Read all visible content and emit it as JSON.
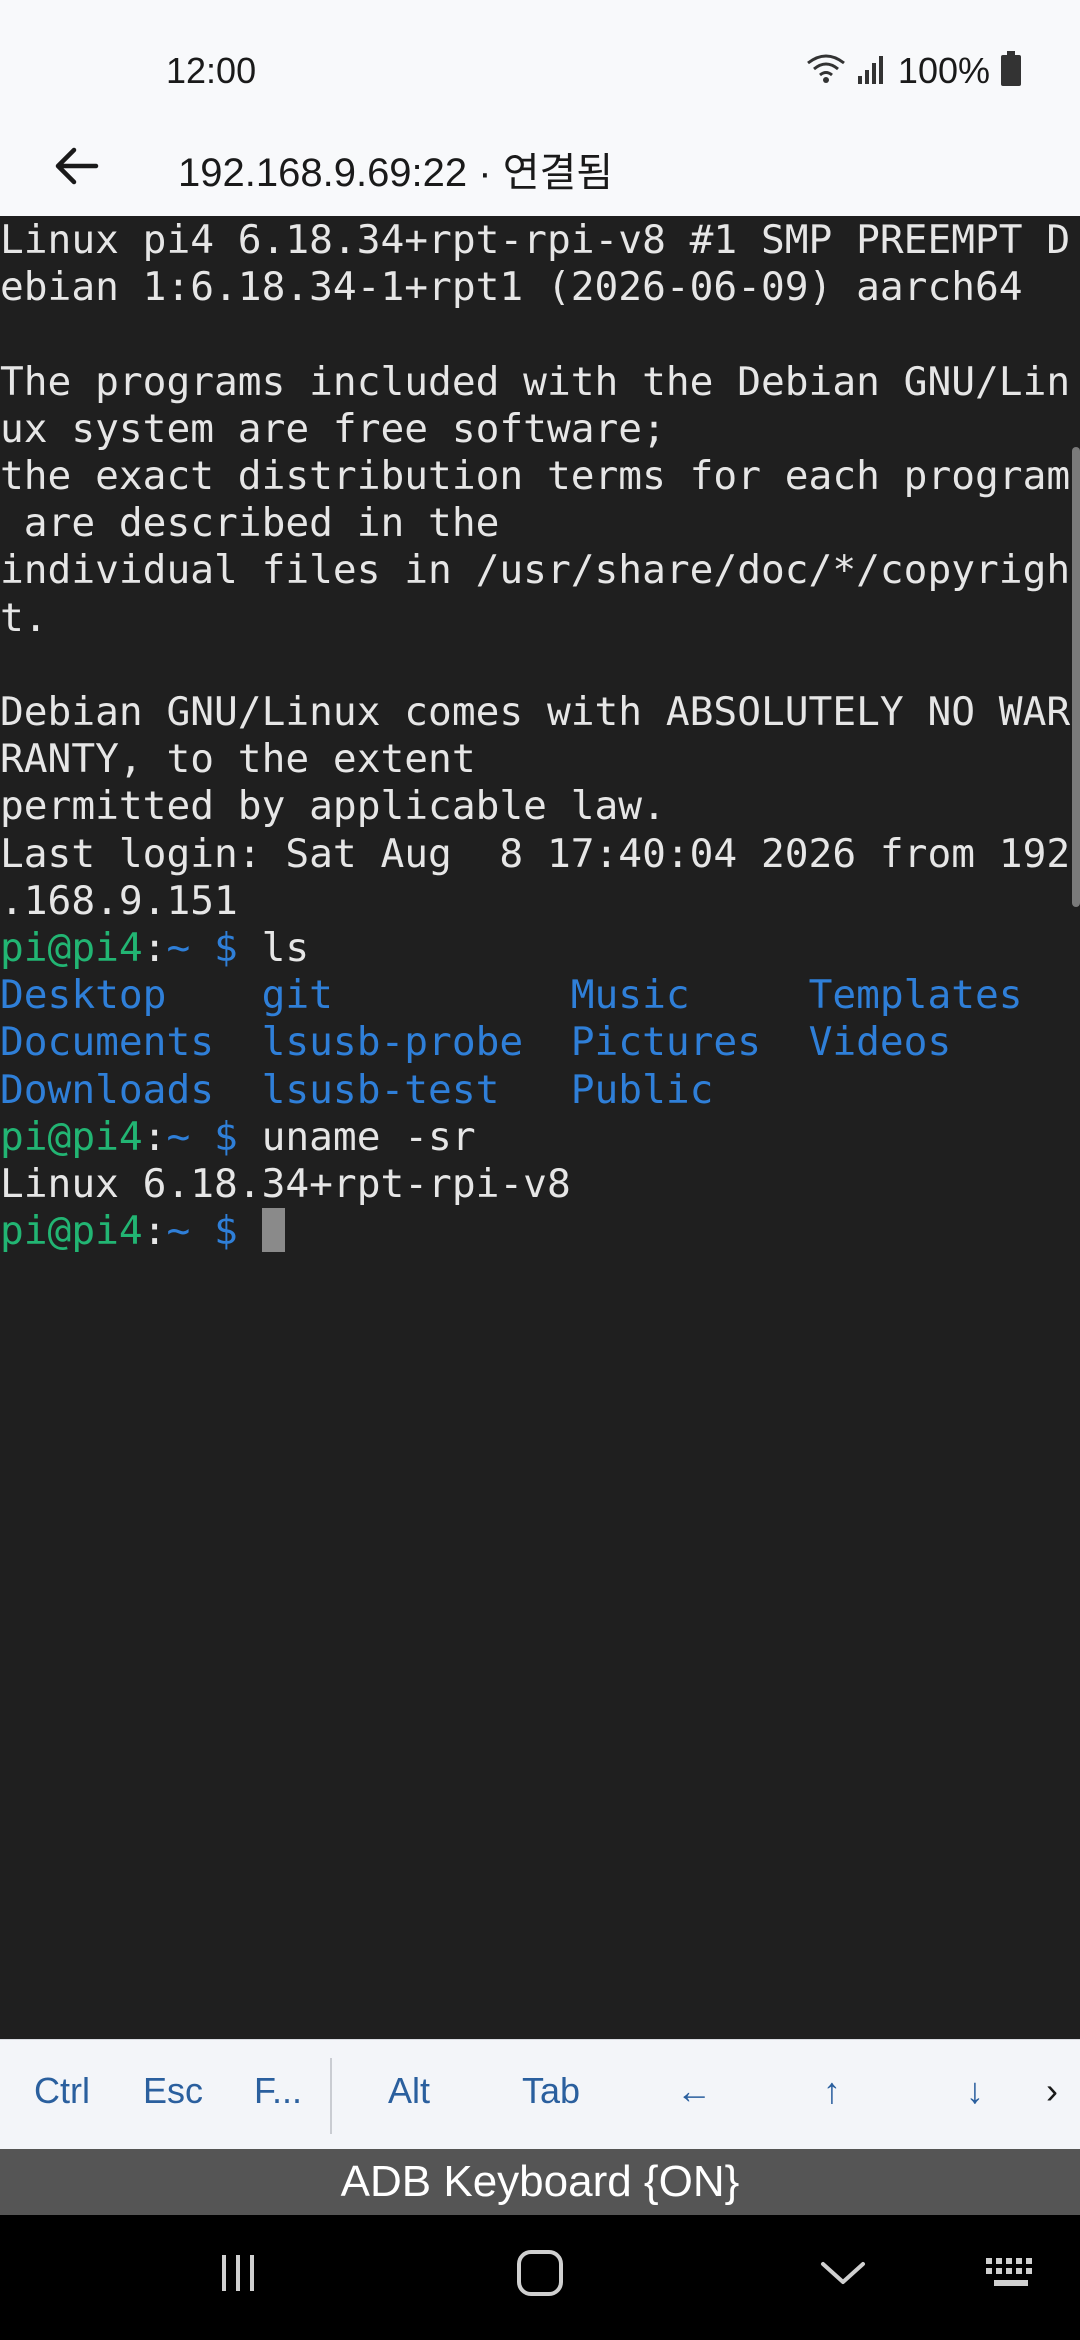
{
  "status_bar": {
    "time": "12:00",
    "battery": "100%"
  },
  "app_bar": {
    "title": "192.168.9.69:22 · 연결됨"
  },
  "terminal": {
    "banner": [
      "Linux pi4 6.18.34+rpt-rpi-v8 #1 SMP PREEMPT D",
      "ebian 1:6.18.34-1+rpt1 (2026-06-09) aarch64",
      "",
      "The programs included with the Debian GNU/Lin",
      "ux system are free software;",
      "the exact distribution terms for each program",
      " are described in the",
      "individual files in /usr/share/doc/*/copyrigh",
      "t.",
      "",
      "Debian GNU/Linux comes with ABSOLUTELY NO WAR",
      "RANTY, to the extent",
      "permitted by applicable law.",
      "Last login: Sat Aug  8 17:40:04 2026 from 192",
      ".168.9.151"
    ],
    "prompt": {
      "user_host": "pi@pi4",
      "path": "~",
      "symbol": "$"
    },
    "cmd1": "ls",
    "ls_rows": [
      [
        "Desktop    ",
        "git          ",
        "Music     ",
        "Templates"
      ],
      [
        "Documents  ",
        "lsusb-probe  ",
        "Pictures  ",
        "Videos"
      ],
      [
        "Downloads  ",
        "lsusb-test   ",
        "Public"
      ]
    ],
    "cmd2": "uname -sr",
    "output2": "Linux 6.18.34+rpt-rpi-v8"
  },
  "extra_keys": {
    "ctrl": "Ctrl",
    "esc": "Esc",
    "fn": "F...",
    "alt": "Alt",
    "tab": "Tab",
    "left": "←",
    "up": "↑",
    "down": "↓",
    "more": "›"
  },
  "adb_keyboard": {
    "label": "ADB Keyboard {ON}"
  },
  "icons": {
    "back": "arrow-left-icon",
    "wifi": "wifi-icon",
    "signal": "signal-icon",
    "battery": "battery-icon",
    "recents": "recents-icon",
    "home": "home-icon",
    "hide_keyboard": "chevron-down-icon",
    "keyboard": "keyboard-icon"
  },
  "colors": {
    "terminal_bg": "#1f1f1f",
    "prompt_user": "#22b573",
    "prompt_path": "#2f7fd8",
    "dir_listing": "#2f7fd8",
    "key_text": "#2a5f9e"
  }
}
